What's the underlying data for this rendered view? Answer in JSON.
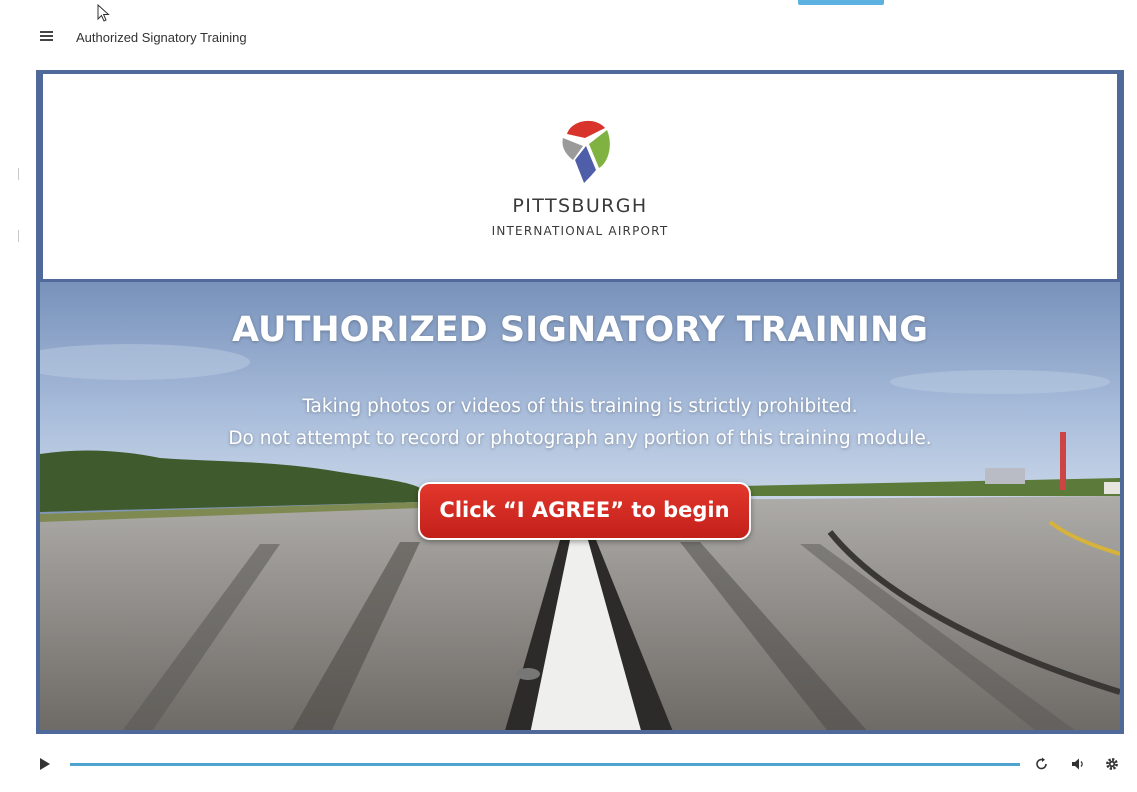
{
  "header": {
    "title": "Authorized Signatory Training",
    "menu_icon": "hamburger-menu-icon"
  },
  "slide": {
    "logo": {
      "name": "PITTSBURGH",
      "subtitle": "INTERNATIONAL AIRPORT",
      "colors": [
        "#d9342b",
        "#7fb241",
        "#4f5ea8",
        "#9a9a9a"
      ]
    },
    "headline": "AUTHORIZED SIGNATORY TRAINING",
    "notice_line1": "Taking photos or videos of this training is strictly prohibited.",
    "notice_line2": "Do not attempt to record or photograph any portion of this training module.",
    "agree_button": "Click “I AGREE” to begin"
  },
  "player": {
    "progress": 1.0,
    "icons": [
      "play-icon",
      "replay-icon",
      "volume-icon",
      "settings-gear-icon"
    ],
    "accent_color": "#4fa3cf"
  }
}
